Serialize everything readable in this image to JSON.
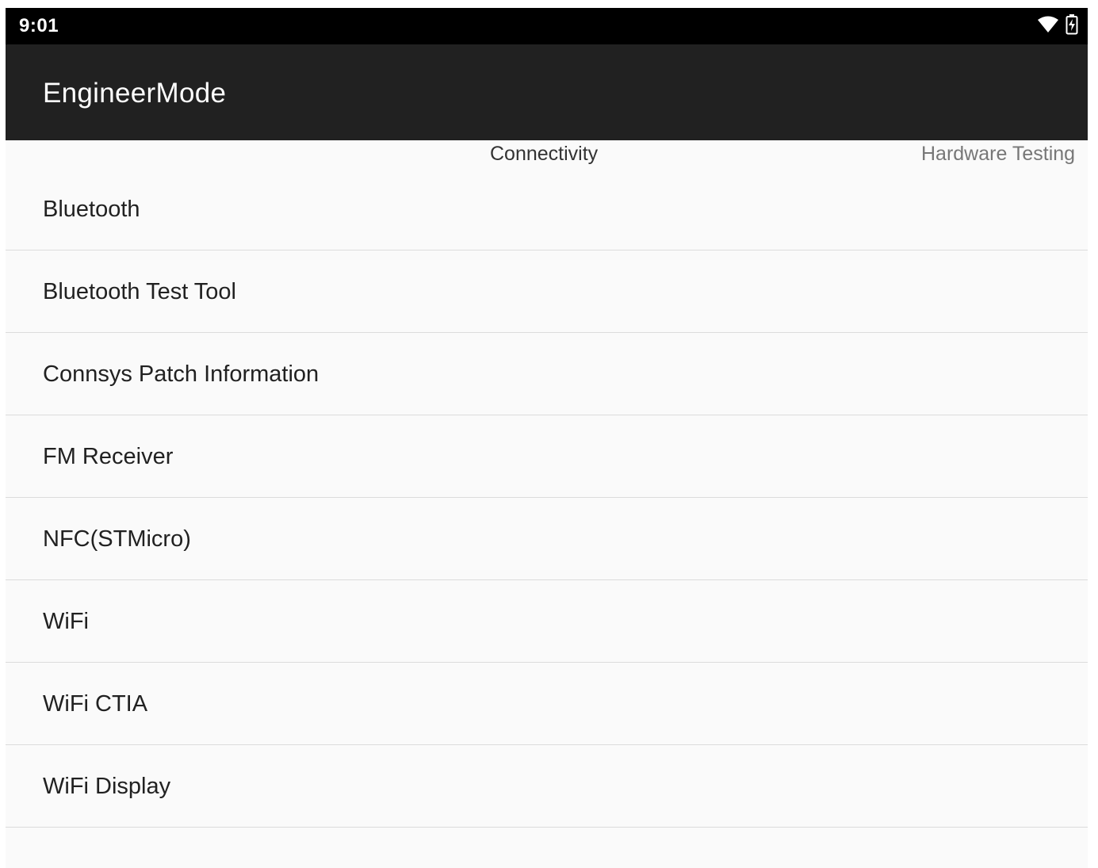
{
  "status_bar": {
    "time": "9:01",
    "icons": [
      "wifi-icon",
      "battery-charging-icon"
    ]
  },
  "app_bar": {
    "title": "EngineerMode"
  },
  "tabs": [
    {
      "label": "Connectivity",
      "active": true
    },
    {
      "label": "Hardware Testing",
      "active": false
    }
  ],
  "list": {
    "items": [
      {
        "label": "Bluetooth"
      },
      {
        "label": "Bluetooth Test Tool"
      },
      {
        "label": "Connsys Patch Information"
      },
      {
        "label": "FM Receiver"
      },
      {
        "label": "NFC(STMicro)"
      },
      {
        "label": "WiFi"
      },
      {
        "label": "WiFi CTIA"
      },
      {
        "label": "WiFi Display"
      },
      {
        "label": ""
      }
    ]
  },
  "colors": {
    "status_bar_bg": "#000000",
    "app_bar_bg": "#212121",
    "content_bg": "#fafafa",
    "divider": "#dcdcdc",
    "text_primary": "#212121",
    "tab_inactive": "#777777"
  }
}
